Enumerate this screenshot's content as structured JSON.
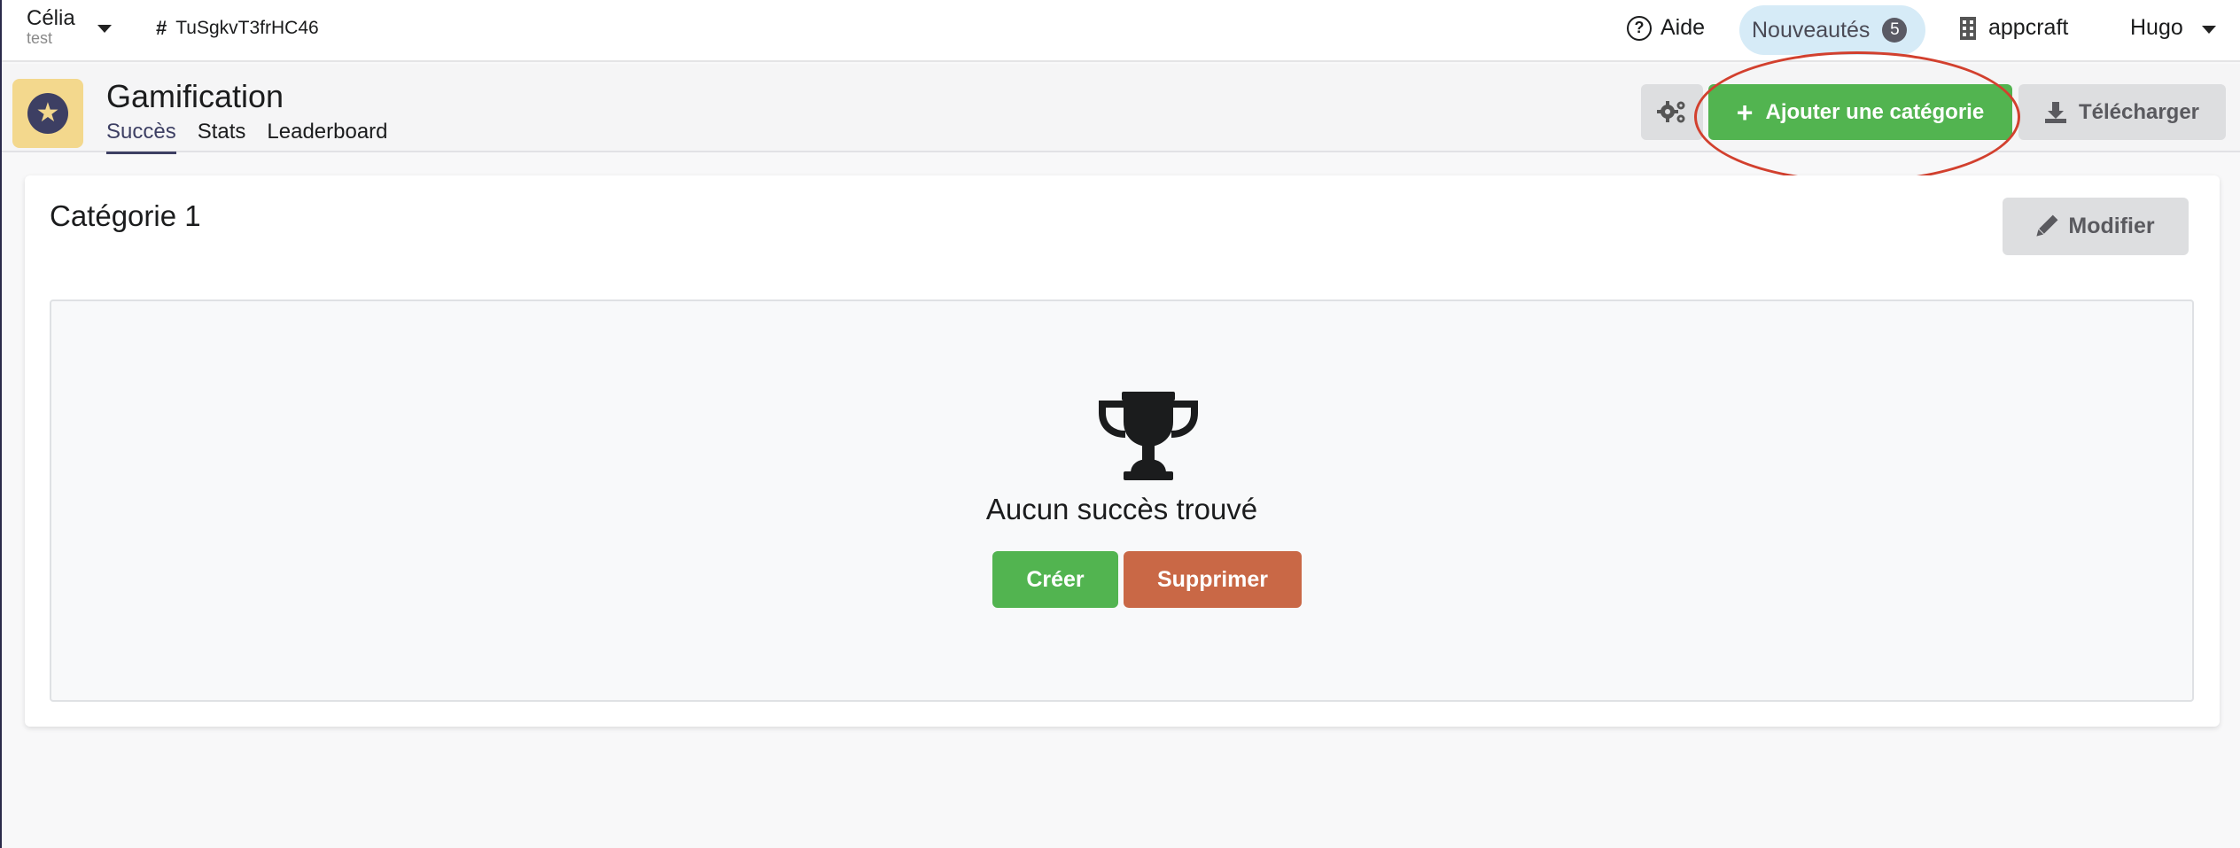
{
  "topbar": {
    "user_name": "Célia",
    "user_sub": "test",
    "project_id": "TuSgkvT3frHC46",
    "help_label": "Aide",
    "news_label": "Nouveautés",
    "news_count": "5",
    "org_label": "appcraft",
    "me_label": "Hugo"
  },
  "header": {
    "title": "Gamification",
    "tabs": [
      {
        "label": "Succès"
      },
      {
        "label": "Stats"
      },
      {
        "label": "Leaderboard"
      }
    ],
    "add_category_label": "Ajouter une catégorie",
    "download_label": "Télécharger"
  },
  "category": {
    "title": "Catégorie 1",
    "edit_label": "Modifier",
    "empty_text": "Aucun succès trouvé",
    "create_label": "Créer",
    "delete_label": "Supprimer"
  },
  "colors": {
    "primary_dark": "#3d3f63",
    "success_green": "#52b450",
    "danger_orange": "#c96846",
    "app_icon_bg": "#f3d88d",
    "highlight_red": "#d2402e",
    "news_bg": "#d6ebf7"
  },
  "icons": {
    "caret": "caret-down-icon",
    "hash": "hash-icon",
    "help": "question-circle-icon",
    "building": "building-icon",
    "star": "star-icon",
    "gears": "gears-icon",
    "plus": "plus-icon",
    "download": "download-icon",
    "pencil": "pencil-icon",
    "trophy": "trophy-icon"
  }
}
